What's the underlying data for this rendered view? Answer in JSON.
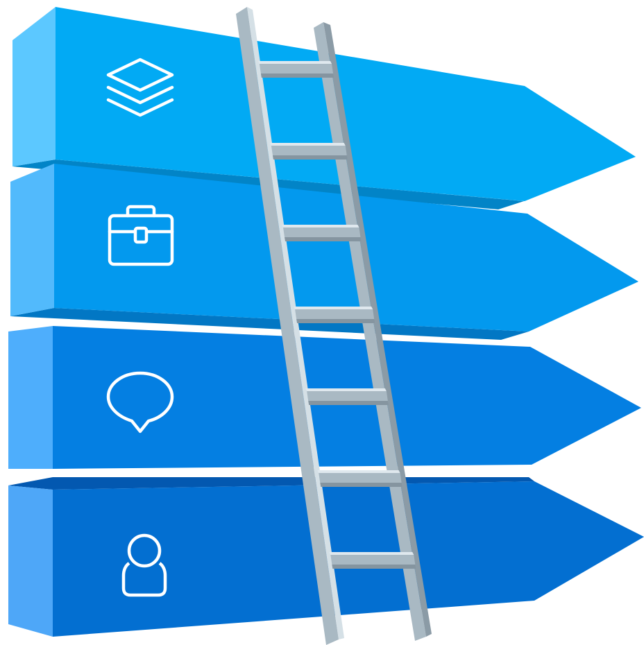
{
  "diagram": {
    "arrows": [
      {
        "icon": "layers-icon",
        "color": "#02aaf4"
      },
      {
        "icon": "briefcase-icon",
        "color": "#0399ee"
      },
      {
        "icon": "speech-bubble-icon",
        "color": "#047fe2"
      },
      {
        "icon": "user-icon",
        "color": "#036fd1"
      }
    ],
    "ladder": {
      "rung_count": 7,
      "color": "#a9b9c3"
    }
  }
}
